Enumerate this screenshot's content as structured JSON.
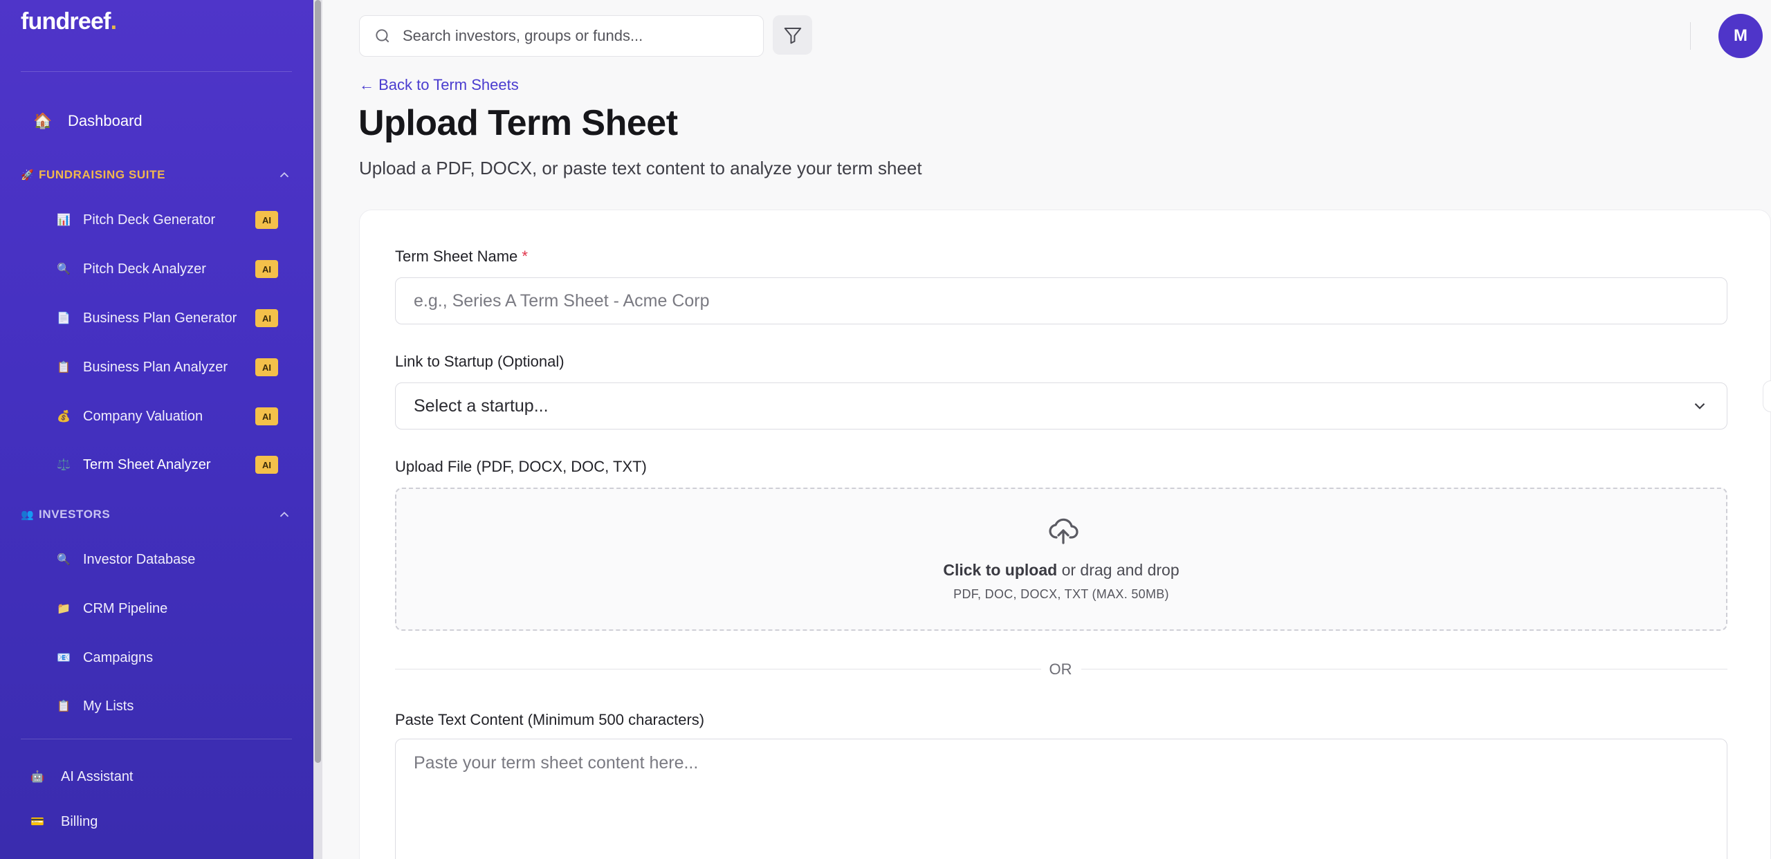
{
  "app": {
    "logo": "fundreef",
    "logo_dot": "."
  },
  "sidebar": {
    "dashboard": {
      "label": "Dashboard",
      "icon": "house-icon"
    },
    "fundraising": {
      "title": "FUNDRAISING SUITE",
      "icon": "rocket-icon",
      "items": [
        {
          "label": "Pitch Deck Generator",
          "badge": "AI",
          "icon": "bar-chart-icon"
        },
        {
          "label": "Pitch Deck Analyzer",
          "badge": "AI",
          "icon": "magnifier-icon"
        },
        {
          "label": "Business Plan Generator",
          "badge": "AI",
          "icon": "document-icon"
        },
        {
          "label": "Business Plan Analyzer",
          "badge": "AI",
          "icon": "clipboard-icon"
        },
        {
          "label": "Company Valuation",
          "badge": "AI",
          "icon": "money-bag-icon"
        },
        {
          "label": "Term Sheet Analyzer",
          "badge": "AI",
          "icon": "scales-icon"
        }
      ]
    },
    "investors": {
      "title": "INVESTORS",
      "icon": "people-icon",
      "items": [
        {
          "label": "Investor Database",
          "icon": "magnifier-icon"
        },
        {
          "label": "CRM Pipeline",
          "icon": "folder-icon"
        },
        {
          "label": "Campaigns",
          "icon": "envelope-icon"
        },
        {
          "label": "My Lists",
          "icon": "clipboard-icon"
        }
      ]
    },
    "bottom": [
      {
        "label": "AI Assistant",
        "icon": "robot-icon"
      },
      {
        "label": "Billing",
        "icon": "credit-card-icon"
      }
    ]
  },
  "header": {
    "search_placeholder": "Search investors, groups or funds...",
    "avatar_initial": "M"
  },
  "page": {
    "back_link": "← Back to Term Sheets",
    "title": "Upload Term Sheet",
    "subtitle": "Upload a PDF, DOCX, or paste text content to analyze your term sheet"
  },
  "form": {
    "name_label": "Term Sheet Name",
    "name_required_mark": "*",
    "name_placeholder": "e.g., Series A Term Sheet - Acme Corp",
    "startup_label": "Link to Startup (Optional)",
    "startup_selected": "Select a startup...",
    "upload_label": "Upload File (PDF, DOCX, DOC, TXT)",
    "upload_action": "Click to upload",
    "upload_action_rest": " or drag and drop",
    "upload_hint": "PDF, DOC, DOCX, TXT (MAX. 50MB)",
    "or_text": "OR",
    "paste_label": "Paste Text Content (Minimum 500 characters)",
    "paste_placeholder": "Paste your term sheet content here..."
  },
  "colors": {
    "sidebar": "#4f35c9",
    "accent": "#4a3ccf",
    "badge": "#f4c04a",
    "section_fundraising": "#f2b84b",
    "required": "#e0334a"
  }
}
